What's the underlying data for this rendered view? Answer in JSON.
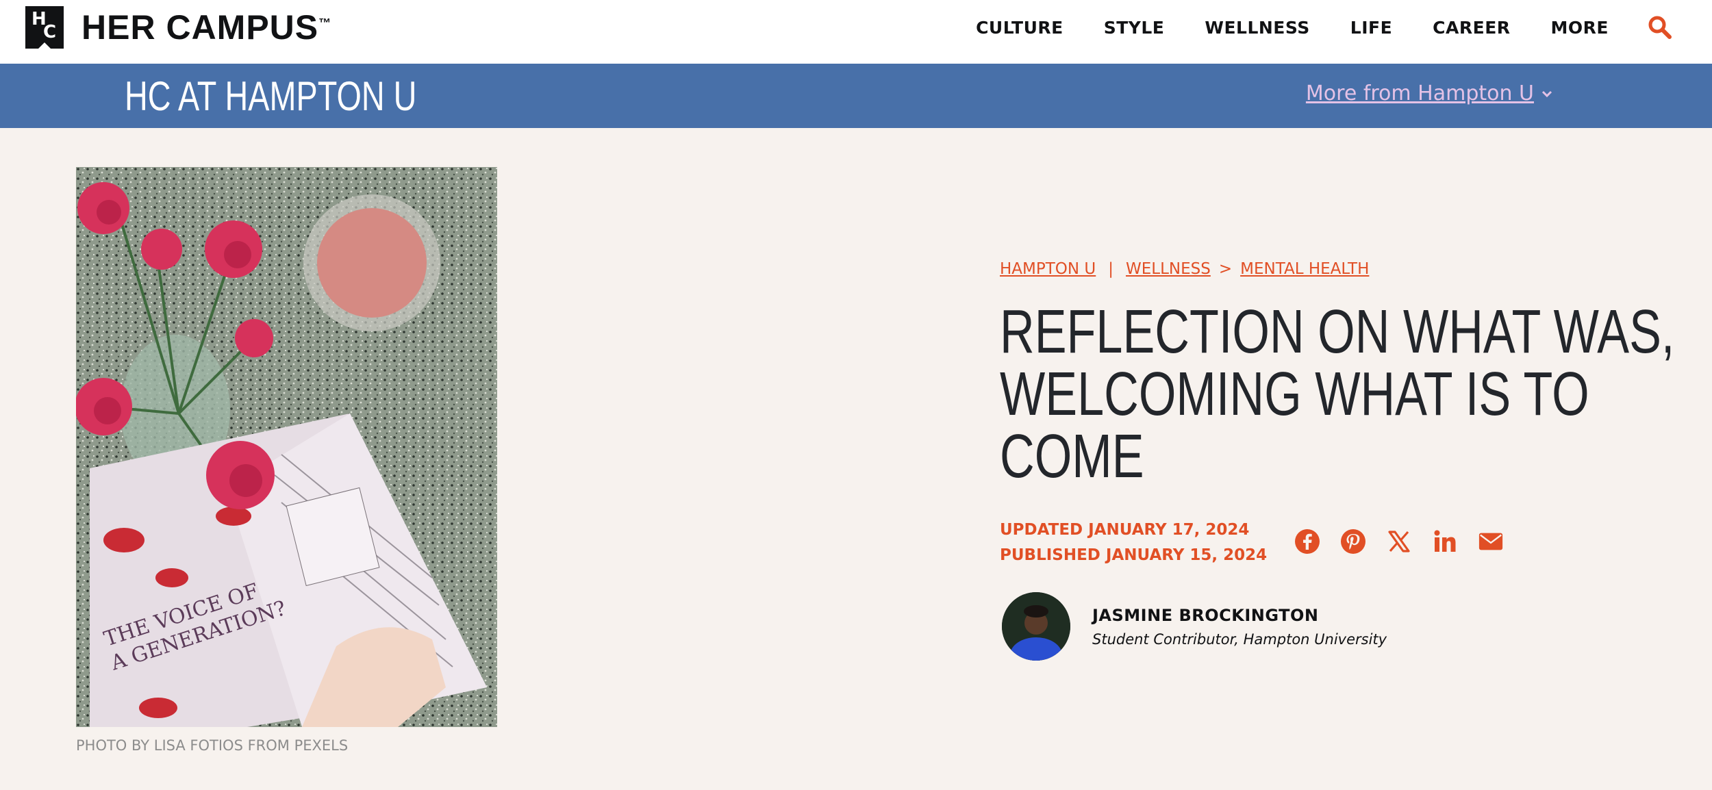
{
  "brand": {
    "logo_h": "H",
    "logo_c": "C",
    "name": "HER CAMPUS",
    "trademark": "™"
  },
  "nav": {
    "items": [
      "CULTURE",
      "STYLE",
      "WELLNESS",
      "LIFE",
      "CAREER",
      "MORE"
    ],
    "search_icon": "search-icon"
  },
  "chapter": {
    "name": "HC AT HAMPTON U",
    "more_link": "More from Hampton U",
    "more_icon": "chevron-down-icon"
  },
  "hero": {
    "caption": "PHOTO BY LISA FOTIOS FROM PEXELS"
  },
  "breadcrumb": {
    "school": "HAMPTON U",
    "separator": "|",
    "section": "WELLNESS",
    "arrow": ">",
    "subsection": "MENTAL HEALTH"
  },
  "article": {
    "title_lines": [
      "REFLECTION ON WHAT WAS,",
      "WELCOMING WHAT IS TO",
      "COME"
    ],
    "updated": "UPDATED JANUARY 17, 2024",
    "published": "PUBLISHED JANUARY 15, 2024"
  },
  "share": {
    "icons": [
      "facebook-icon",
      "pinterest-icon",
      "x-icon",
      "linkedin-icon",
      "email-icon"
    ],
    "color": "#e14f25"
  },
  "author": {
    "name": "JASMINE BROCKINGTON",
    "role": "Student Contributor, Hampton University"
  },
  "colors": {
    "accent": "#e14f25",
    "chapter_bar": "#4870a9",
    "page_bg": "#f7f2ee",
    "link_on_blue": "#e4c2e6"
  }
}
